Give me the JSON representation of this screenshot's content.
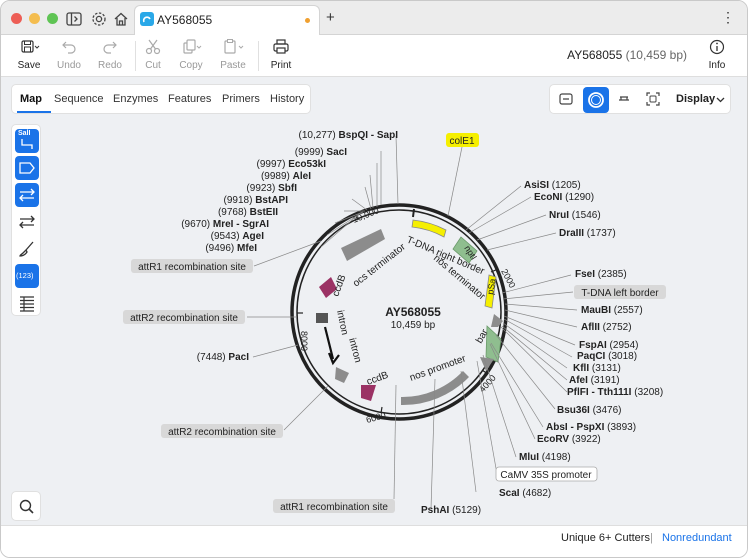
{
  "window": {
    "tab_title": "AY568055",
    "new_tab_label": "+",
    "more_menu": "⋮"
  },
  "toolbar": {
    "save_label": "Save",
    "undo_label": "Undo",
    "redo_label": "Redo",
    "cut_label": "Cut",
    "copy_label": "Copy",
    "paste_label": "Paste",
    "print_label": "Print",
    "info_label": "Info",
    "sequence_name": "AY568055",
    "sequence_length": "(10,459 bp)"
  },
  "view_tabs": [
    "Map",
    "Sequence",
    "Enzymes",
    "Features",
    "Primers",
    "History"
  ],
  "display_label": "Display",
  "sidebar": {
    "sall_label": "SalI",
    "count_label": "(123)"
  },
  "map": {
    "center_name": "AY568055",
    "center_length": "10,459 bp",
    "ticks": [
      "2000",
      "4000",
      "6000",
      "8000",
      "10,000"
    ],
    "features_inner": {
      "ocs_terminator": "ocs terminator",
      "ccdb1": "ccdB",
      "intron1": "intron",
      "intron2": "intron",
      "ccdb2": "ccdB",
      "nos_promoter": "nos promoter",
      "bar": "bar",
      "tdna_right": "T-DNA right border",
      "nos_terminator": "nos terminator",
      "nptI": "nptI",
      "psa": "pSa"
    },
    "boxed_labels": {
      "colE1": "colE1",
      "attR1_top": "attR1 recombination site",
      "attR2_mid": "attR2 recombination site",
      "attR2_bottom": "attR2 recombination site",
      "attR1_bottom": "attR1 recombination site",
      "tdna_left": "T-DNA left border",
      "camv": "CaMV 35S promoter"
    },
    "sites_left": [
      {
        "name": "BspQI - SapI",
        "pos": "(10,277)"
      },
      {
        "name": "SacI",
        "pos": "(9999)"
      },
      {
        "name": "Eco53kI",
        "pos": "(9997)"
      },
      {
        "name": "AleI",
        "pos": "(9989)"
      },
      {
        "name": "SbfI",
        "pos": "(9923)"
      },
      {
        "name": "BstAPI",
        "pos": "(9918)"
      },
      {
        "name": "BstEII",
        "pos": "(9768)"
      },
      {
        "name": "MreI - SgrAI",
        "pos": "(9670)"
      },
      {
        "name": "AgeI",
        "pos": "(9543)"
      },
      {
        "name": "MfeI",
        "pos": "(9496)"
      },
      {
        "name": "PacI",
        "pos": "(7448)"
      }
    ],
    "sites_right": [
      {
        "name": "AsiSI",
        "pos": "(1205)"
      },
      {
        "name": "EcoNI",
        "pos": "(1290)"
      },
      {
        "name": "NruI",
        "pos": "(1546)"
      },
      {
        "name": "DraIII",
        "pos": "(1737)"
      },
      {
        "name": "FseI",
        "pos": "(2385)"
      },
      {
        "name": "MauBI",
        "pos": "(2557)"
      },
      {
        "name": "AflII",
        "pos": "(2752)"
      },
      {
        "name": "FspAI",
        "pos": "(2954)"
      },
      {
        "name": "PaqCI",
        "pos": "(3018)"
      },
      {
        "name": "KflI",
        "pos": "(3131)"
      },
      {
        "name": "AfeI",
        "pos": "(3191)"
      },
      {
        "name": "PflFI - Tth111I",
        "pos": "(3208)"
      },
      {
        "name": "Bsu36I",
        "pos": "(3476)"
      },
      {
        "name": "AbsI - PspXI",
        "pos": "(3893)"
      },
      {
        "name": "EcoRV",
        "pos": "(3922)"
      },
      {
        "name": "MluI",
        "pos": "(4198)"
      },
      {
        "name": "ScaI",
        "pos": "(4682)"
      },
      {
        "name": "PshAI",
        "pos": "(5129)"
      }
    ]
  },
  "status": {
    "cutters": "Unique 6+ Cutters",
    "separator": "|",
    "nonredundant": "Nonredundant"
  },
  "colors": {
    "accent": "#1a73e8",
    "yellow_feature": "#f5ef00",
    "green_feature": "#8fbe8f",
    "gray_feature": "#8c8c8c",
    "ccdb": "#9b3264"
  }
}
